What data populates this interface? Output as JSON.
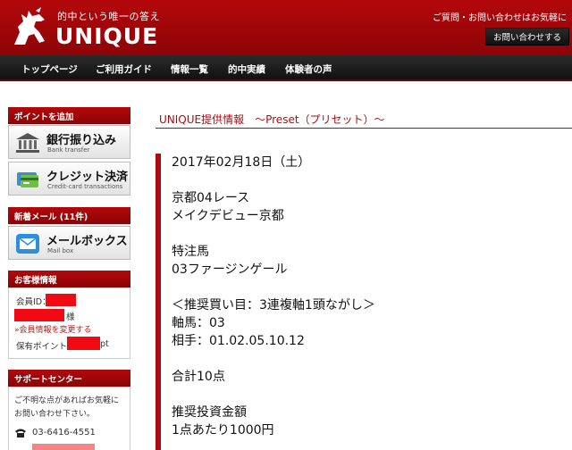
{
  "header": {
    "tagline": "的中という唯一の答え",
    "brand": "UNIQUE",
    "contact_text": "ご質問・お問い合わせはお気軽に",
    "contact_button": "お問い合わせする"
  },
  "nav": {
    "items": [
      "トップページ",
      "ご利用ガイド",
      "情報一覧",
      "的中実績",
      "体験者の声"
    ]
  },
  "sidebar": {
    "points_heading": "ポイントを追加",
    "bank": {
      "label": "銀行振り込み",
      "sub": "Bank transfer"
    },
    "credit": {
      "label": "クレジット決済",
      "sub": "Credit-card transactions"
    },
    "mail_heading": "新着メール (11件)",
    "mailbox": {
      "label": "メールボックス",
      "sub": "Mail box"
    },
    "customer_heading": "お客様情報",
    "member_id_label": "会員ID：",
    "honorific": "様",
    "change_link": "»会員情報を変更する",
    "points_label": "保有ポイント：",
    "points_suffix": "pt",
    "support_heading": "サポートセンター",
    "support_text_1": "ご不明な点があればお気軽に",
    "support_text_2": "お問い合わせ下さい。",
    "phone": "03-6416-4551"
  },
  "main": {
    "title": "UNIQUE提供情報　～Preset（プリセット）～",
    "lines": [
      "2017年02月18日（土）",
      "",
      "京都04レース",
      "メイクデビュー京都",
      "",
      "特注馬",
      "03ファージンゲール",
      "",
      "＜推奨買い目：3連複軸1頭ながし＞",
      "軸馬：03",
      "相手：01.02.05.10.12",
      "",
      "合計10点",
      "",
      "推奨投資金額",
      "1点あたり1000円"
    ]
  },
  "colors": {
    "brand_red": "#b3080b",
    "nav_dark": "#1a1a1a",
    "accent_red": "#b5080d"
  }
}
